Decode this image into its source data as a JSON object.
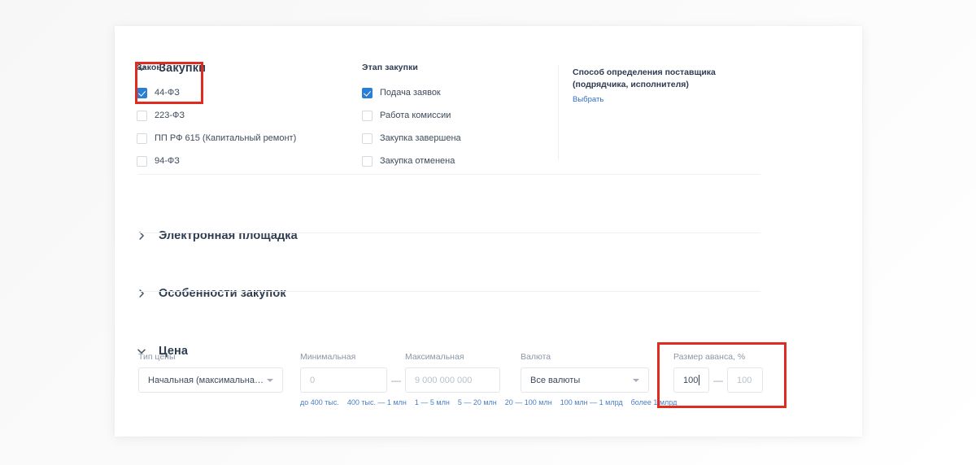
{
  "sections": {
    "procurements": {
      "title": "Закупки",
      "chevron": "chevron-down-icon",
      "law": {
        "label": "Закон",
        "options": [
          {
            "label": "44-ФЗ",
            "checked": true
          },
          {
            "label": "223-ФЗ",
            "checked": false
          },
          {
            "label": "ПП РФ 615 (Капитальный ремонт)",
            "checked": false
          },
          {
            "label": "94-ФЗ",
            "checked": false
          }
        ]
      },
      "stage": {
        "label": "Этап закупки",
        "options": [
          {
            "label": "Подача заявок",
            "checked": true
          },
          {
            "label": "Работа комиссии",
            "checked": false
          },
          {
            "label": "Закупка завершена",
            "checked": false
          },
          {
            "label": "Закупка отменена",
            "checked": false
          }
        ]
      },
      "supplier_method": {
        "line1": "Способ определения поставщика",
        "line2": "(подрядчика, исполнителя)",
        "link": "Выбрать"
      }
    },
    "platform": {
      "title": "Электронная площадка",
      "chevron": "chevron-right-icon"
    },
    "features": {
      "title": "Особенности закупок",
      "chevron": "chevron-right-icon"
    },
    "price": {
      "title": "Цена",
      "chevron": "chevron-down-icon",
      "price_type": {
        "label": "Тип цены",
        "value": "Начальная (максимальная) цена к..."
      },
      "minimum": {
        "label": "Минимальная",
        "placeholder": "0",
        "value": ""
      },
      "maximum": {
        "label": "Максимальная",
        "placeholder": "9 000 000 000",
        "value": ""
      },
      "range_dash": "—",
      "currency": {
        "label": "Валюта",
        "value": "Все валюты"
      },
      "advance": {
        "label": "Размер аванса, %",
        "from_value": "100",
        "to_placeholder": "100",
        "to_value": "",
        "dash": "—"
      },
      "quick_links": [
        "до 400 тыс.",
        "400 тыс. — 1 млн",
        "1 — 5 млн",
        "5 — 20 млн",
        "20 — 100 млн",
        "100 млн — 1 млрд",
        "более 1 млрд"
      ]
    }
  },
  "colors": {
    "accent": "#2a7fd4",
    "link": "#4a7ec4",
    "annotation": "#e02b20",
    "heading": "#2e3c50"
  }
}
